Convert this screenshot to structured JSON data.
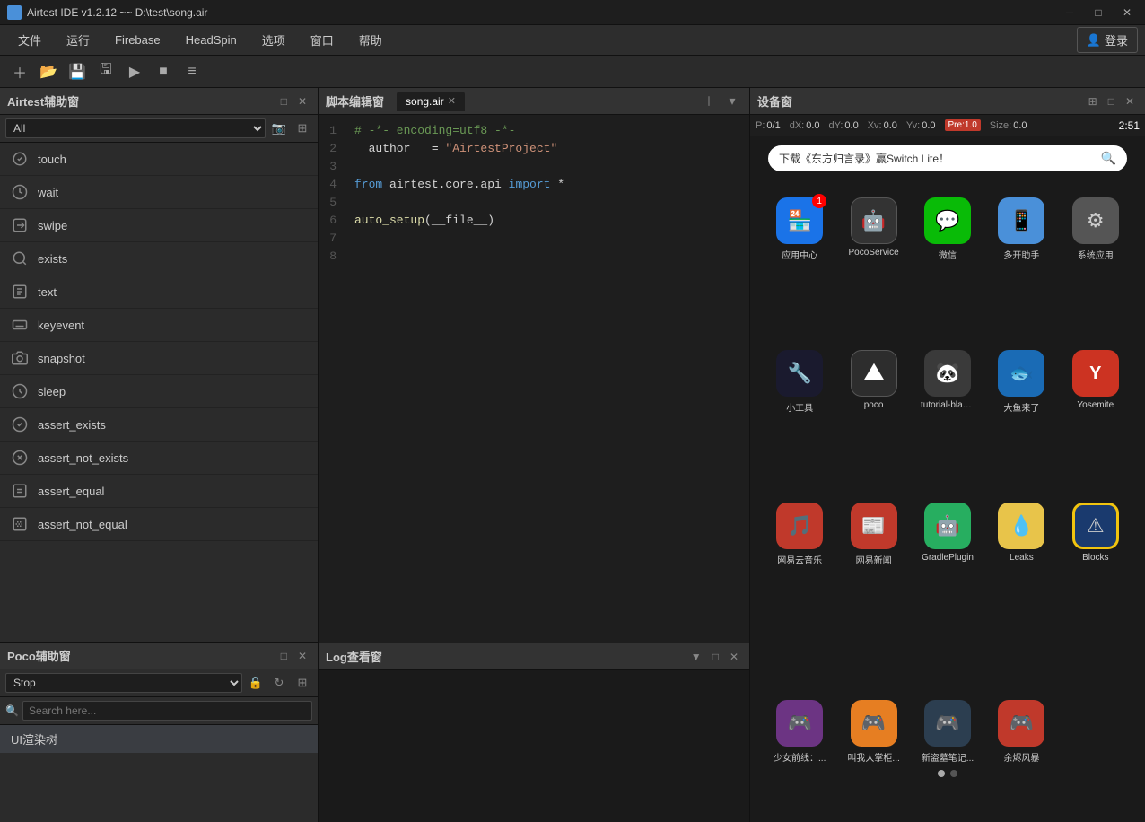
{
  "titleBar": {
    "title": "Airtest IDE v1.2.12 ~~ D:\\test\\song.air",
    "minBtn": "─",
    "maxBtn": "□",
    "closeBtn": "✕"
  },
  "menuBar": {
    "items": [
      {
        "label": "文件"
      },
      {
        "label": "运行"
      },
      {
        "label": "Firebase"
      },
      {
        "label": "HeadSpin"
      },
      {
        "label": "选项"
      },
      {
        "label": "窗口"
      },
      {
        "label": "帮助"
      }
    ],
    "loginLabel": "登录"
  },
  "toolbar": {
    "buttons": [
      "＋",
      "📂",
      "💾",
      "🖫",
      "▶",
      "■",
      "≡"
    ]
  },
  "airtestPanel": {
    "title": "Airtest辅助窗",
    "filterPlaceholder": "All",
    "items": [
      {
        "label": "touch",
        "icon": "touch"
      },
      {
        "label": "wait",
        "icon": "wait"
      },
      {
        "label": "swipe",
        "icon": "swipe"
      },
      {
        "label": "exists",
        "icon": "exists"
      },
      {
        "label": "text",
        "icon": "text"
      },
      {
        "label": "keyevent",
        "icon": "key"
      },
      {
        "label": "snapshot",
        "icon": "snap"
      },
      {
        "label": "sleep",
        "icon": "sleep"
      },
      {
        "label": "assert_exists",
        "icon": "assert"
      },
      {
        "label": "assert_not_exists",
        "icon": "assert"
      },
      {
        "label": "assert_equal",
        "icon": "assert"
      },
      {
        "label": "assert_not_equal",
        "icon": "assert"
      }
    ]
  },
  "editorPanel": {
    "title": "脚本编辑窗",
    "activeTab": "song.air",
    "code": [
      {
        "num": 1,
        "text": "# -*- encoding=utf8 -*-",
        "type": "comment"
      },
      {
        "num": 2,
        "text": "__author__ = \"AirtestProject\"",
        "type": "string"
      },
      {
        "num": 3,
        "text": "",
        "type": "normal"
      },
      {
        "num": 4,
        "text": "from airtest.core.api import *",
        "type": "keyword"
      },
      {
        "num": 5,
        "text": "",
        "type": "normal"
      },
      {
        "num": 6,
        "text": "auto_setup(__file__)",
        "type": "func"
      },
      {
        "num": 7,
        "text": "",
        "type": "normal"
      },
      {
        "num": 8,
        "text": "",
        "type": "normal"
      }
    ]
  },
  "logPanel": {
    "title": "Log查看窗"
  },
  "devicePanel": {
    "title": "设备窗",
    "infoBar": {
      "P": "0/1",
      "dX": "0.0",
      "dY": "0.0",
      "Xv": "0.0",
      "Yv": "0.0",
      "Pre": "1.0",
      "Size": "0.0",
      "time": "2:51"
    },
    "searchPlaceholder": "下载《东方归言录》赢Switch Lite！",
    "appsRow1": [
      {
        "name": "应用中心",
        "bg": "#1a73e8",
        "icon": "🏪",
        "badge": "1"
      },
      {
        "name": "PocoService",
        "bg": "#2d2d2d",
        "icon": "🤖",
        "badge": ""
      },
      {
        "name": "微信",
        "bg": "#09BB07",
        "icon": "💬",
        "badge": ""
      },
      {
        "name": "多开助手",
        "bg": "#4a90d9",
        "icon": "📱",
        "badge": ""
      },
      {
        "name": "系统应用",
        "bg": "#555",
        "icon": "⚙",
        "badge": ""
      }
    ],
    "appsRow2": [
      {
        "name": "小工具",
        "bg": "#1a1a2e",
        "icon": "🔧",
        "badge": ""
      },
      {
        "name": "poco",
        "bg": "#2d2d2d",
        "icon": "◆",
        "badge": ""
      },
      {
        "name": "tutorial-blackja...",
        "bg": "#333",
        "icon": "🐼",
        "badge": ""
      },
      {
        "name": "大鱼来了",
        "bg": "#1a6bb5",
        "icon": "🐟",
        "badge": ""
      },
      {
        "name": "Yosemite",
        "bg": "#e74c3c",
        "icon": "Y",
        "badge": ""
      }
    ],
    "appsRow3": [
      {
        "name": "网易云音乐",
        "bg": "#c0392b",
        "icon": "🎵",
        "badge": ""
      },
      {
        "name": "网易新闻",
        "bg": "#c0392b",
        "icon": "📰",
        "badge": ""
      },
      {
        "name": "GradlePlugin",
        "bg": "#27ae60",
        "icon": "🤖",
        "badge": ""
      },
      {
        "name": "Leaks",
        "bg": "#f39c12",
        "icon": "💧",
        "badge": ""
      },
      {
        "name": "Blocks",
        "bg": "#f1c40f",
        "icon": "⚠",
        "badge": ""
      }
    ],
    "appsRow4": [
      {
        "name": "少女前线：...",
        "bg": "#8e44ad",
        "icon": "🎮",
        "badge": ""
      },
      {
        "name": "叫我大掌柜...",
        "bg": "#e67e22",
        "icon": "🎮",
        "badge": ""
      },
      {
        "name": "新盗墓笔记...",
        "bg": "#2c3e50",
        "icon": "🎮",
        "badge": ""
      },
      {
        "name": "余烬风暴",
        "bg": "#c0392b",
        "icon": "🎮",
        "badge": ""
      }
    ]
  },
  "pocoPanel": {
    "title": "Poco辅助窗",
    "selectValue": "Stop",
    "searchPlaceholder": "Search here...",
    "uiTreeLabel": "UI渲染树"
  }
}
